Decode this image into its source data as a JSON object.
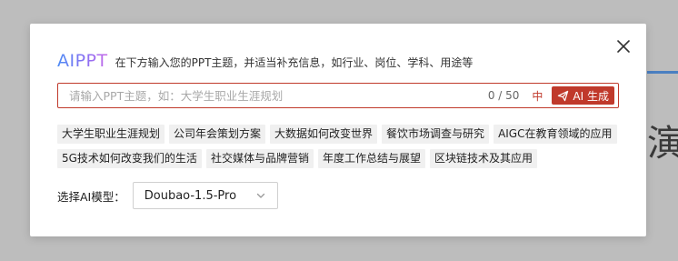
{
  "background": {
    "partial_glyph": "演"
  },
  "dialog": {
    "brand": "AIPPT",
    "subtitle": "在下方输入您的PPT主题，并适当补充信息，如行业、岗位、学科、用途等",
    "close_icon": "close-icon",
    "input": {
      "value": "",
      "placeholder": "请输入PPT主题，如：大学生职业生涯规划",
      "counter": "0 / 50",
      "lang_indicator": "中",
      "generate_label": "AI 生成",
      "generate_icon": "send-icon"
    },
    "tags": [
      "大学生职业生涯规划",
      "公司年会策划方案",
      "大数据如何改变世界",
      "餐饮市场调查与研究",
      "AIGC在教育领域的应用",
      "5G技术如何改变我们的生活",
      "社交媒体与品牌营销",
      "年度工作总结与展望",
      "区块链技术及其应用"
    ],
    "model": {
      "label": "选择AI模型：",
      "selected": "Doubao-1.5-Pro",
      "dropdown_icon": "chevron-down-icon"
    }
  },
  "colors": {
    "accent": "#c0392b",
    "brand_gradient_start": "#4c8bf5",
    "brand_gradient_end": "#c86ae8",
    "tag_background": "#f0f0f0",
    "overlay": "#bdbdbd"
  }
}
